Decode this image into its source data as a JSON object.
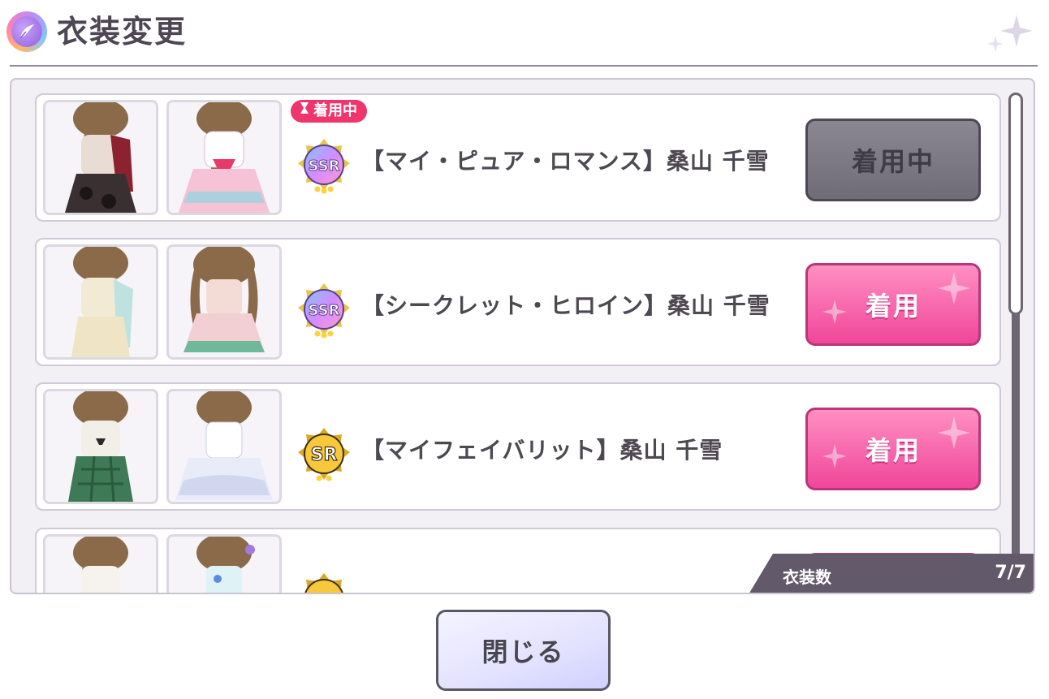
{
  "header": {
    "title": "衣装変更"
  },
  "outfits": [
    {
      "badge": "着用中",
      "rarity": "SSR",
      "name": "【マイ・ピュア・ロマンス】桑山 千雪",
      "button_label": "着用中",
      "state": "wearing"
    },
    {
      "badge": "",
      "rarity": "SSR",
      "name": "【シークレット・ヒロイン】桑山 千雪",
      "button_label": "着用",
      "state": "available"
    },
    {
      "badge": "",
      "rarity": "SR",
      "name": "【マイフェイバリット】桑山 千雪",
      "button_label": "着用",
      "state": "available"
    },
    {
      "badge": "",
      "rarity": "SR",
      "name": "",
      "button_label": "",
      "state": "available"
    }
  ],
  "count": {
    "label": "衣装数",
    "value": "7/7"
  },
  "close_button": {
    "label": "閉じる"
  },
  "colors": {
    "accent_pink": "#f0469a",
    "badge_red": "#f0346c",
    "disabled_gray": "#7d7984",
    "panel_bg": "#f2eff5"
  }
}
